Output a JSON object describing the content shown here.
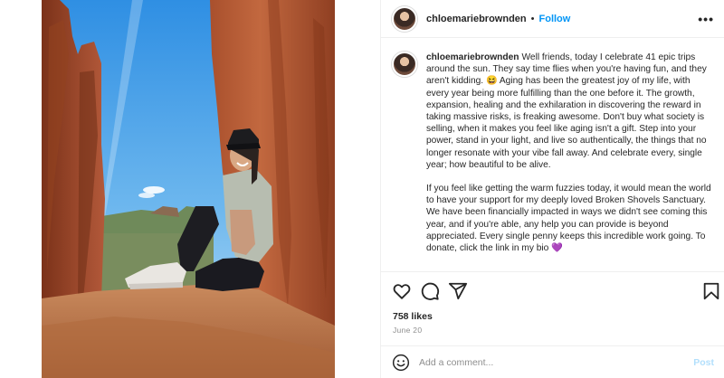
{
  "post": {
    "username": "chloemariebrownden",
    "separator": "•",
    "follow_label": "Follow",
    "more_icon": "more-horizontal-icon",
    "caption_paragraphs": [
      "Well friends, today I celebrate 41 epic trips around the sun. They say time flies when you're having fun, and they aren't kidding. 😆 Aging has been the greatest joy of my life, with every year being more fulfilling than the one before it. The growth, expansion, healing and the exhilaration in discovering the reward in taking massive risks, is freaking awesome. Don't buy what society is selling, when it makes you feel like aging isn't a gift. Step into your power, stand in your light, and live so authentically, the things that no longer resonate with your vibe fall away. And celebrate every, single year; how beautiful to be alive.",
      "If you feel like getting the warm fuzzies today, it would mean the world to have your support for my deeply loved Broken Shovels Sanctuary. We have been financially impacted in ways we didn't see coming this year, and if you're able, any help you can provide is beyond appreciated. Every single penny keeps this incredible work going. To donate, click the link in my bio 💜"
    ],
    "likes": "758 likes",
    "date": "June 20"
  },
  "comment": {
    "placeholder": "Add a comment...",
    "post_label": "Post"
  },
  "colors": {
    "follow_blue": "#0095f6",
    "post_disabled": "#b2dffc",
    "muted_text": "#8e8e8e",
    "divider": "#efefef"
  },
  "icons": [
    "heart-icon",
    "comment-icon",
    "share-icon",
    "bookmark-icon",
    "emoji-icon"
  ]
}
